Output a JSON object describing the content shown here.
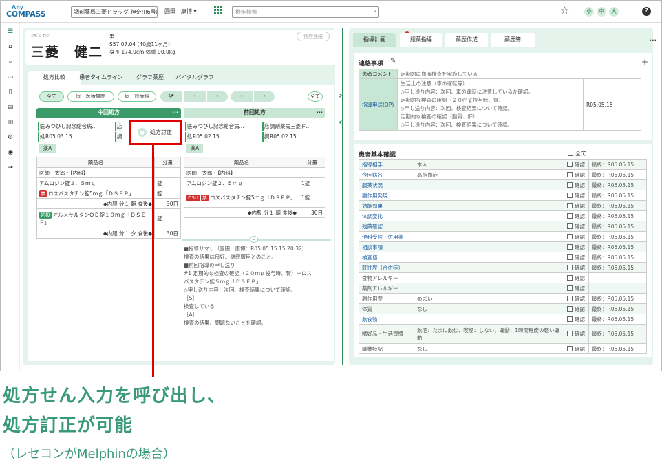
{
  "header": {
    "logo_any": "Any",
    "logo_compass": "COMPASS",
    "store": "調剤薬局三菱ドラッグ 神奈川6号店",
    "user": "園田　康博",
    "search_placeholder": "機能検索",
    "shift_buttons": [
      "小",
      "中",
      "大"
    ],
    "help": "?"
  },
  "patient": {
    "kana": "ﾐﾂﾋﾞｼ ｹﾝｼﾞ",
    "name": "三菱　健二",
    "sex": "男",
    "birth": "S57.07.04 (40歳11ヶ月)",
    "body": "身長 174.0cm 体重 90.0kg",
    "other_store": "他店連絡"
  },
  "left_tabs": [
    "処方比較",
    "患者タイムライン",
    "グラフ薬歴",
    "バイタルグラフ"
  ],
  "filters": {
    "all": "全て",
    "same_inst": "同一医療機関",
    "same_dept": "同一診療科",
    "all2": "全て"
  },
  "current": {
    "title": "今回処方",
    "hospital_key": "医",
    "hospital": "みつびし記念総合病...",
    "store_key": "店",
    "issue_key": "処",
    "date": "R05.03.15",
    "prep_key": "調",
    "group": "薬A"
  },
  "previous": {
    "title": "前回処方",
    "hospital_key": "医",
    "hospital": "みつびし記念総合病...",
    "store_key": "店",
    "store": "調剤薬局三菱ド...",
    "issue_key": "処",
    "date": "R05.02.15",
    "prep_key": "調",
    "prep": "R05.02.15",
    "group": "薬A"
  },
  "drug_table": {
    "col_name": "薬品名",
    "col_qty": "分量"
  },
  "current_drugs": {
    "doctor": "医師　太郎・【内科】",
    "d1": "アムロジン錠２．５ｍｇ",
    "d1q": "錠",
    "d2tag": "禁",
    "d2": "ロスバスタチン錠5ｍｇ「ＤＳＥＰ」",
    "d2q": "錠",
    "u1": "◆内服 分１ 朝 食後◆",
    "u1q": "30日",
    "d3tag": "初投",
    "d3": "オルメサルタンＯＤ錠１０ｍｇ「ＤＳＥＰ」",
    "d3q": "錠",
    "u2": "◆内服 分１ 夕 食後◆",
    "u2q": "30日"
  },
  "previous_drugs": {
    "doctor": "医師　太郎・【内科】",
    "d1": "アムロジン錠２．５ｍｇ",
    "d1q": "1錠",
    "d2tag1": "DSU",
    "d2tag2": "禁",
    "d2": "ロスバスタチン錠5ｍｇ「ＤＳＥＰ」",
    "d2q": "1錠",
    "u1": "◆内服 分１ 朝 食後◆",
    "u1q": "30日"
  },
  "fix_button": "処方訂正",
  "history": [
    "■指導サマリ（園田　康博：R05.05.15 15:20:32）",
    "検査の結果は良好。継続服用とのこと。",
    "",
    "■前回指導の申し送り",
    "#1 定期的な検査の確認（２０ｍｇ投与時、腎）ーロス",
    "バスタチン錠５ｍｇ「ＤＳＥＰ」",
    "◇申し送り内容：次回、検査結果について確認。",
    "［S］",
    "検査している",
    "［A］",
    "検査の結果、問題ないことを確認。"
  ],
  "right_tabs": [
    "指導計画",
    "服薬指導",
    "薬歴作成",
    "薬歴簿"
  ],
  "contact": {
    "title": "連絡事項",
    "comment_label": "患者コメント",
    "comment": "定期的に血液検査を実施している",
    "sendover_label": "指導申送(OP)",
    "sendover_lines": [
      "生活上の注意（車の運転等）",
      "◇申し送り内容：次回、車の運転に注意しているか確認。",
      "定期的な検査の確認（２０ｍｇ投与時、腎）",
      "◇申し送り内容：次回、検査結果について確認。",
      "定期的な検査の確認（脂質、肝）",
      "◇申し送り内容：次回、検査結果について確認。"
    ],
    "sendover_date": "R05.05.15"
  },
  "basic": {
    "title": "患者基本確認",
    "all": "全て",
    "check": "確認",
    "rows": [
      {
        "label": "指導相手",
        "value": "本人",
        "last": "最終：R05.05.15",
        "link": true
      },
      {
        "label": "今回病名",
        "value": "高脂血症",
        "last": "最終：R05.05.15",
        "link": true
      },
      {
        "label": "服薬状況",
        "value": "",
        "last": "最終：R05.05.15",
        "link": true
      },
      {
        "label": "副作用発現",
        "value": "",
        "last": "最終：R05.05.15",
        "link": true
      },
      {
        "label": "効能効果",
        "value": "",
        "last": "最終：R05.05.15",
        "link": true
      },
      {
        "label": "体調変化",
        "value": "",
        "last": "最終：R05.05.15",
        "link": true
      },
      {
        "label": "残薬確認",
        "value": "",
        "last": "最終：R05.05.15",
        "link": true
      },
      {
        "label": "他科受診・併用薬",
        "value": "",
        "last": "最終：R05.05.15",
        "link": true
      },
      {
        "label": "相談事項",
        "value": "",
        "last": "最終：R05.05.15",
        "link": true
      },
      {
        "label": "検査値",
        "value": "",
        "last": "最終：R05.05.15",
        "link": true
      },
      {
        "label": "既往歴（合併症）",
        "value": "",
        "last": "最終：R05.05.15",
        "link": true
      },
      {
        "label": "食物アレルギー",
        "value": "",
        "last": "",
        "link": false
      },
      {
        "label": "薬剤アレルギー",
        "value": "",
        "last": "",
        "link": false
      },
      {
        "label": "副作用歴",
        "value": "めまい",
        "last": "最終：R05.05.15",
        "link": false
      },
      {
        "label": "体質",
        "value": "なし",
        "last": "最終：R05.05.15",
        "link": false
      },
      {
        "label": "飲食物",
        "value": "",
        "last": "最終：R05.05.15",
        "link": true
      },
      {
        "label": "嗜好品・生活習慣",
        "value": "飲酒：たまに飲む、喫煙：しない、運動：1時間程度の軽い運動",
        "last": "最終：R05.05.15",
        "link": false
      },
      {
        "label": "職業特記",
        "value": "なし",
        "last": "最終：R05.05.15",
        "link": false
      }
    ]
  },
  "caption": {
    "line1": "処方せん入力を呼び出し、",
    "line2": "処方訂正が可能",
    "line3": "（レセコンがMelphinの場合）"
  },
  "colors": {
    "accent": "#2e8b57",
    "highlight": "#e00000",
    "caption": "#3a9a78"
  }
}
